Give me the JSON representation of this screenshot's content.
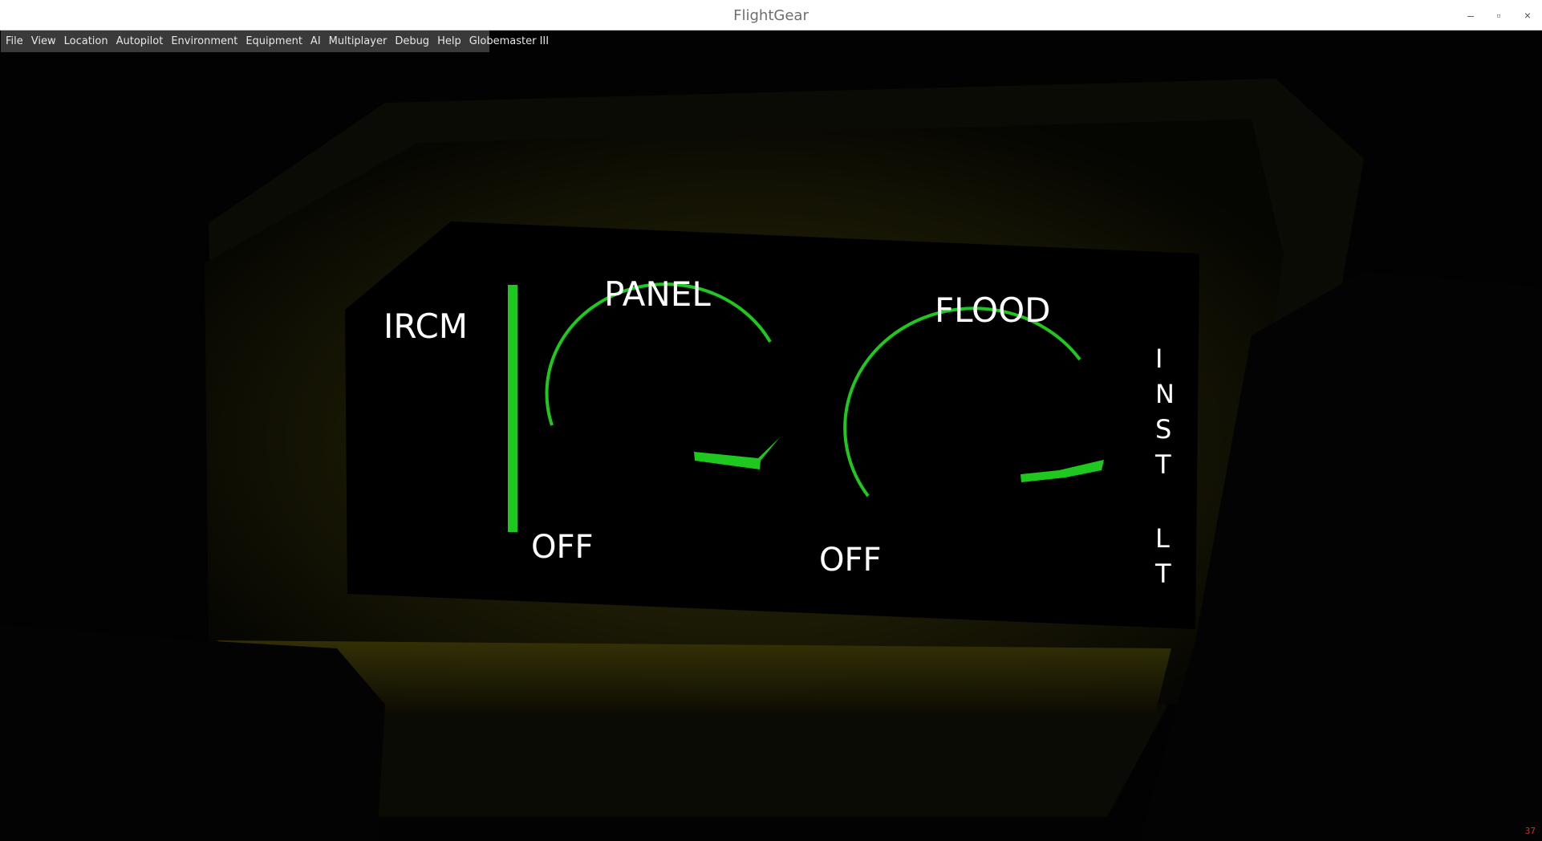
{
  "window": {
    "title": "FlightGear",
    "controls": {
      "minimize": "–",
      "maximize": "▫",
      "close": "×"
    }
  },
  "menubar": {
    "items": [
      {
        "label": "File"
      },
      {
        "label": "View"
      },
      {
        "label": "Location"
      },
      {
        "label": "Autopilot"
      },
      {
        "label": "Environment"
      },
      {
        "label": "Equipment"
      },
      {
        "label": "AI"
      },
      {
        "label": "Multiplayer"
      },
      {
        "label": "Debug"
      },
      {
        "label": "Help"
      },
      {
        "label": "Globemaster III"
      }
    ]
  },
  "panel": {
    "ircm_label": "IRCM",
    "panel_label": "PANEL",
    "flood_label": "FLOOD",
    "panel_off_label": "OFF",
    "flood_off_label": "OFF",
    "inst_lt_letters": [
      "I",
      "N",
      "S",
      "T",
      "L",
      "T"
    ],
    "indicator_color": "#1ec81e",
    "backlight_color": "#2b2a06"
  },
  "status": {
    "fps": "37"
  }
}
